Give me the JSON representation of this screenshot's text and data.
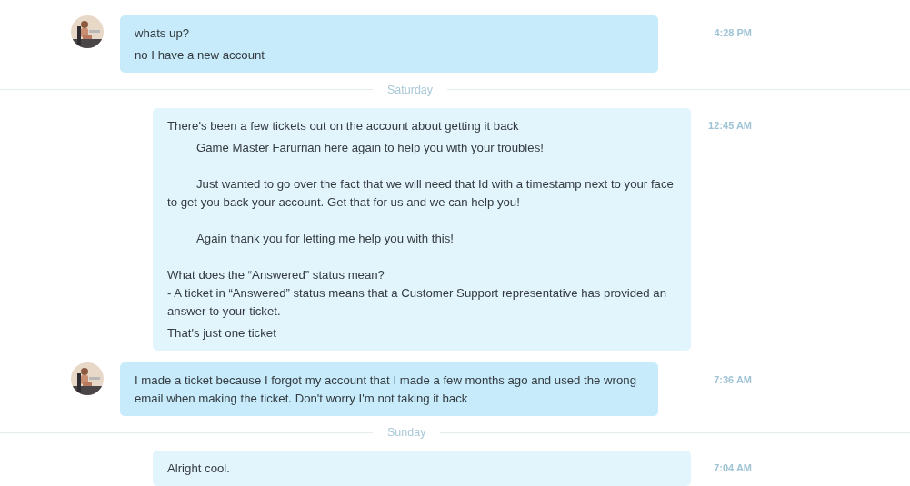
{
  "conversation": [
    {
      "kind": "incoming",
      "avatar": true,
      "parts": [
        "whats up?",
        "no I have a new account"
      ],
      "time": "4:28 PM"
    },
    {
      "kind": "divider",
      "label": "Saturday"
    },
    {
      "kind": "outgoing",
      "avatar": false,
      "parts": [
        "There's been a few tickets out on the account about getting it back",
        "\tGame Master Farurrian here again to help you with your troubles!\n\n\tJust wanted to go over the fact that we will need that Id with a timestamp next to your face to get you back your account. Get that for us and we can help you!\n\n\tAgain thank you for letting me help you with this!\n\nWhat does the “Answered” status mean?\n- A ticket in “Answered” status means that a Customer Support representative has provided an answer to your ticket.",
        "That's just one ticket"
      ],
      "time": "12:45 AM"
    },
    {
      "kind": "incoming",
      "avatar": true,
      "parts": [
        "I made a ticket because I forgot my account that I made a few months ago and used the wrong email when making the ticket. Don't worry I'm not taking it back"
      ],
      "time": "7:36 AM"
    },
    {
      "kind": "divider",
      "label": "Sunday"
    },
    {
      "kind": "outgoing",
      "avatar": false,
      "parts": [
        "Alright cool."
      ],
      "time": "7:04 AM"
    }
  ]
}
